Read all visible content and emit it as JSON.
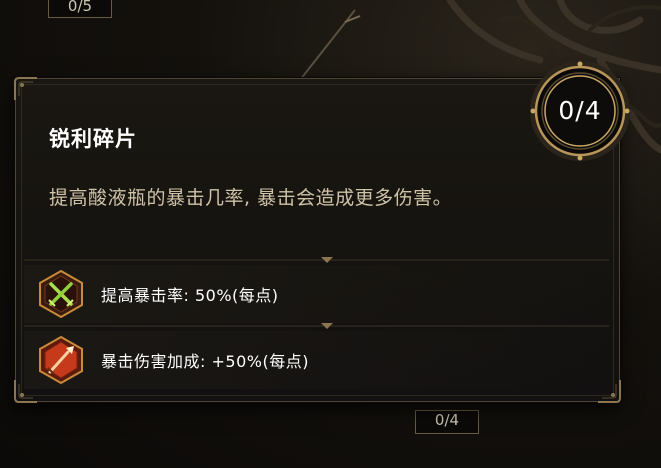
{
  "background": {
    "counter_top": "0/5",
    "counter_bottom": "0/4"
  },
  "tooltip": {
    "title": "锐利碎片",
    "rank": "0/4",
    "description": "提高酸液瓶的暴击几率, 暴击会造成更多伤害。",
    "stats": [
      {
        "icon": "crossed-swords-icon",
        "label": "提高暴击率: 50%(每点)"
      },
      {
        "icon": "spear-burst-icon",
        "label": "暴击伤害加成: +50%(每点)"
      }
    ]
  },
  "colors": {
    "panel_border": "#4e4535",
    "gold_accent": "#b8955a",
    "title_text": "#ffffff",
    "description_text": "#cfc3a8",
    "icon_red": "#c63a1c",
    "icon_green": "#8fd13a"
  }
}
